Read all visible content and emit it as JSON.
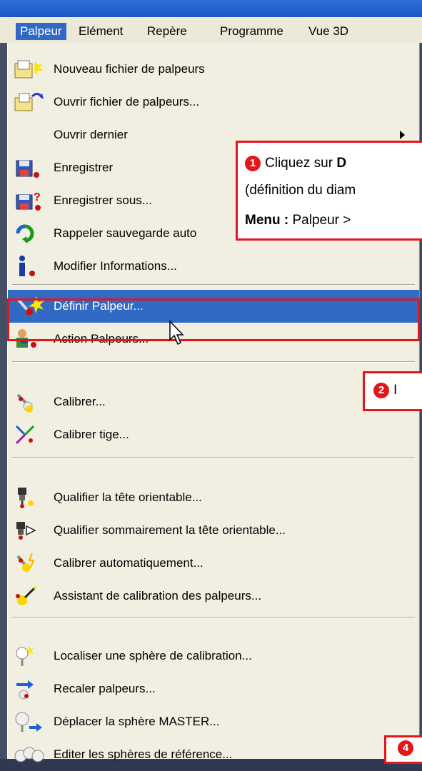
{
  "menubar": [
    {
      "label": "Palpeur",
      "active": true
    },
    {
      "label": "Elément",
      "active": false
    },
    {
      "label": "Repère",
      "active": false
    },
    {
      "label": "Programme",
      "active": false
    },
    {
      "label": "Vue 3D",
      "active": false
    }
  ],
  "menu": {
    "items": [
      {
        "label": "Nouveau fichier de palpeurs",
        "icon": "new-file-icon"
      },
      {
        "label": "Ouvrir fichier de palpeurs...",
        "icon": "open-file-icon"
      },
      {
        "label": "Ouvrir dernier",
        "icon": "",
        "submenu": true
      },
      {
        "label": "Enregistrer",
        "icon": "save-icon"
      },
      {
        "label": "Enregistrer sous...",
        "icon": "save-as-icon"
      },
      {
        "label": "Rappeler sauvegarde auto",
        "icon": "restore-icon"
      },
      {
        "label": "Modifier Informations...",
        "icon": "info-icon"
      },
      {
        "label": "Définir Palpeur...",
        "icon": "define-probe-icon",
        "highlighted": true
      },
      {
        "label": "Action Palpeurs...",
        "icon": "probe-action-icon"
      },
      {
        "label": "Calibrer...",
        "icon": "calibrate-icon"
      },
      {
        "label": "Calibrer tige...",
        "icon": "calibrate-stylus-icon"
      },
      {
        "label": "Qualifier la tête orientable...",
        "icon": "qualify-head-icon"
      },
      {
        "label": "Qualifier sommairement la tête orientable...",
        "icon": "quick-qualify-head-icon"
      },
      {
        "label": "Calibrer automatiquement...",
        "icon": "auto-calibrate-icon"
      },
      {
        "label": "Assistant de calibration des palpeurs...",
        "icon": "calibration-wizard-icon"
      },
      {
        "label": "Localiser une sphère de calibration...",
        "icon": "locate-sphere-icon"
      },
      {
        "label": "Recaler palpeurs...",
        "icon": "realign-probes-icon"
      },
      {
        "label": "Déplacer la sphère MASTER...",
        "icon": "move-sphere-icon"
      },
      {
        "label": "Editer les sphères de référence...",
        "icon": "edit-spheres-icon"
      }
    ]
  },
  "callouts": {
    "c1_num": "1",
    "c1_text_a": "Cliquez sur ",
    "c1_text_b": "D",
    "c1_line2": "(définition du diam",
    "c1_menu_label": "Menu :",
    "c1_menu_path": " Palpeur >",
    "c2_num": "2",
    "c2_text": "I",
    "c4_num": "4"
  },
  "colors": {
    "accent": "#e3161b",
    "highlight": "#316ac5",
    "menu_bg": "#f1efe2"
  }
}
